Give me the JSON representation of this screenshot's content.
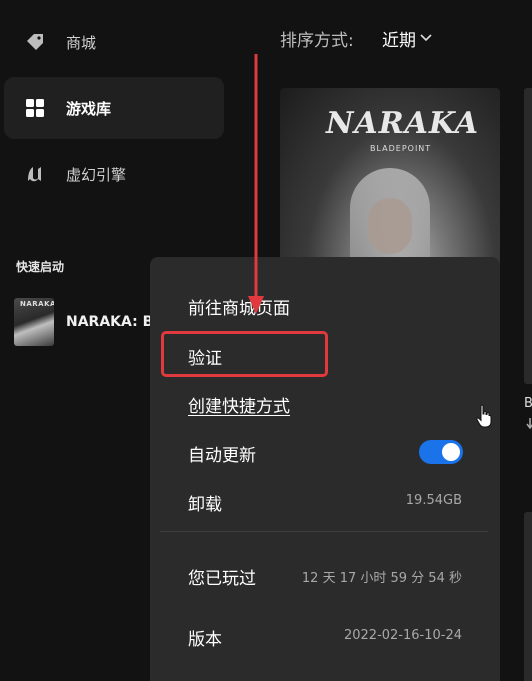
{
  "sidebar": {
    "items": [
      {
        "label": "商城",
        "icon": "tag-icon",
        "active": false
      },
      {
        "label": "游戏库",
        "icon": "grid-icon",
        "active": true
      },
      {
        "label": "虚幻引擎",
        "icon": "unreal-icon",
        "active": false
      }
    ],
    "quick_launch": {
      "title": "快速启动",
      "items": [
        {
          "label": "NARAKA: BL",
          "thumb_text": "NARAKA"
        }
      ]
    }
  },
  "main": {
    "sort": {
      "label": "排序方式:",
      "value": "近期"
    },
    "card": {
      "logo": "NARAKA",
      "sublogo": "BLADEPOINT"
    },
    "partial_letter": "B"
  },
  "context_menu": {
    "items": [
      {
        "label": "前往商城页面"
      },
      {
        "label": "验证"
      },
      {
        "label": "创建快捷方式"
      },
      {
        "label": "自动更新",
        "toggle_on": true
      },
      {
        "label": "卸载",
        "value": "19.54GB"
      },
      {
        "label": "您已玩过",
        "value": "12 天 17 小时 59 分 54 秒"
      },
      {
        "label": "版本",
        "value": "2022-02-16-10-24"
      }
    ]
  },
  "colors": {
    "background": "#121212",
    "menu_bg": "#2b2b2b",
    "toggle_on": "#1a73e8",
    "annotation_red": "#e0393e"
  }
}
